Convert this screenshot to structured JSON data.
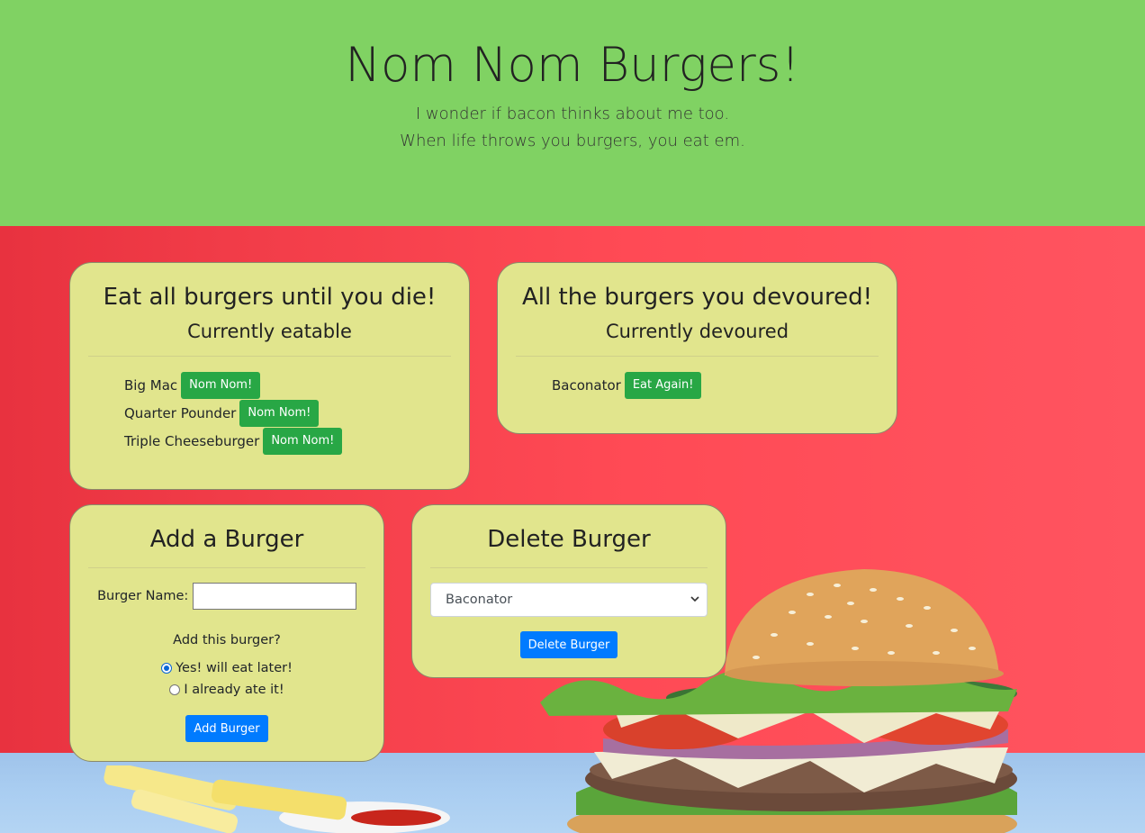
{
  "header": {
    "title": "Nom Nom Burgers!",
    "lead_1": "I wonder if bacon thinks about me too.",
    "lead_2": "When life throws you burgers, you eat em."
  },
  "eatable": {
    "title": "Eat all burgers until you die!",
    "subtitle": "Currently eatable",
    "items": [
      {
        "name": "Big Mac",
        "button": "Nom Nom!"
      },
      {
        "name": "Quarter Pounder",
        "button": "Nom Nom!"
      },
      {
        "name": "Triple Cheeseburger",
        "button": "Nom Nom!"
      }
    ]
  },
  "devoured": {
    "title": "All the burgers you devoured!",
    "subtitle": "Currently devoured",
    "items": [
      {
        "name": "Baconator",
        "button": "Eat Again!"
      }
    ]
  },
  "add": {
    "title": "Add a Burger",
    "name_label": "Burger Name:",
    "name_value": "",
    "question": "Add this burger?",
    "option_later": "Yes! will eat later!",
    "option_ate": "I already ate it!",
    "selected_option": "later",
    "submit": "Add Burger"
  },
  "delete": {
    "title": "Delete Burger",
    "selected": "Baconator",
    "submit": "Delete Burger"
  },
  "colors": {
    "header_bg": "#80d263",
    "card_bg": "#e1e58d",
    "button_green": "#28a745",
    "button_blue": "#007bff",
    "background_red": "#ff4a55"
  }
}
